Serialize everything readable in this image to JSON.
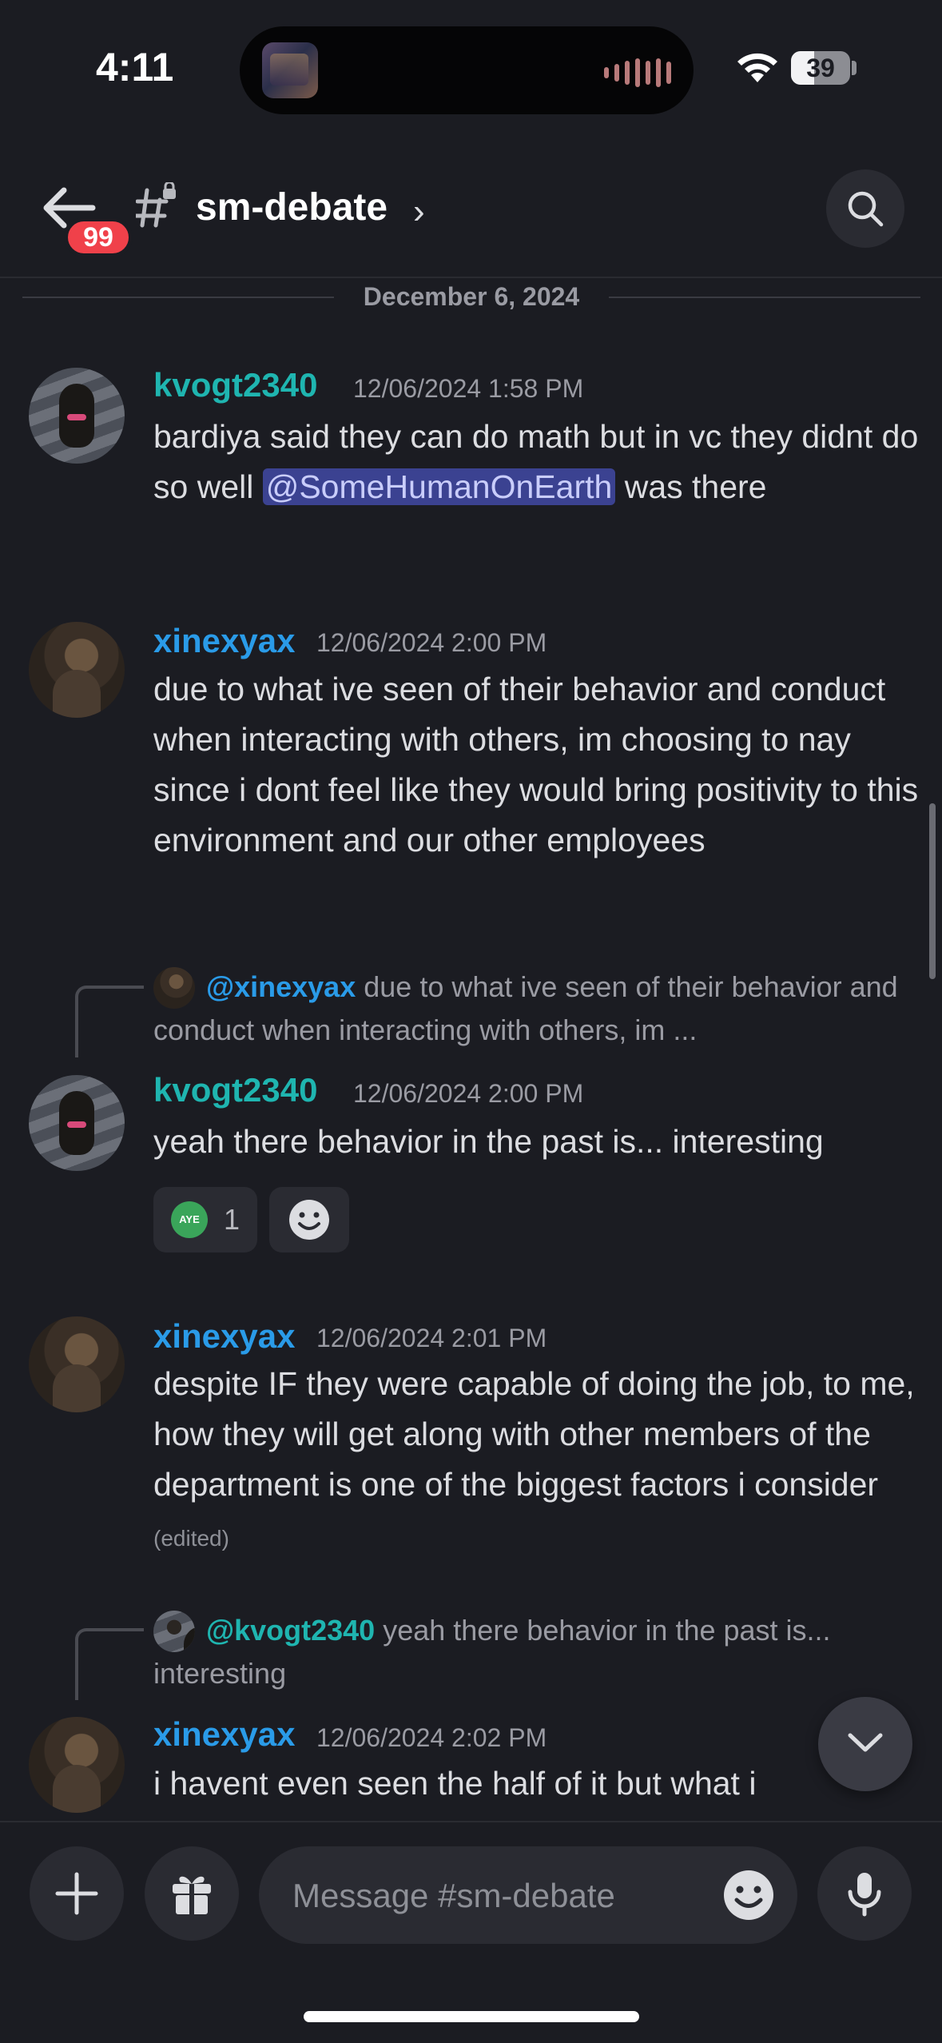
{
  "status_bar": {
    "time": "4:11",
    "battery": "39"
  },
  "header": {
    "unread_badge": "99",
    "channel_name": "sm-debate",
    "chevron": "›"
  },
  "date_divider": "December 6, 2024",
  "messages": [
    {
      "author": "kvogt2340",
      "timestamp": "12/06/2024 1:58 PM",
      "text_before": "bardiya said they can do math but in vc they didnt do so well ",
      "mention": "@SomeHumanOnEarth",
      "text_after": " was there"
    },
    {
      "author": "xinexyax",
      "timestamp": "12/06/2024 2:00 PM",
      "text": "due to what ive seen of their behavior and conduct when interacting with others, im choosing to nay since i dont feel like they would bring positivity to this environment and our other employees"
    },
    {
      "author": "kvogt2340",
      "timestamp": "12/06/2024 2:00 PM",
      "reply_to": "@xinexyax",
      "reply_text": "due to what ive seen of their behavior and conduct when interacting with others, im ...",
      "text": "yeah there behavior in the past is... interesting",
      "reaction": {
        "emoji_label": "AYE",
        "count": "1"
      }
    },
    {
      "author": "xinexyax",
      "timestamp": "12/06/2024 2:01 PM",
      "text": "despite IF they were capable of doing the job, to me, how they will get along with other members of the department is one of the biggest factors i consider",
      "edited": "(edited)"
    },
    {
      "author": "xinexyax",
      "timestamp": "12/06/2024 2:02 PM",
      "reply_to": "@kvogt2340",
      "reply_text": "yeah there behavior in the past is... interesting",
      "text": "i havent even seen the half of it but what i"
    }
  ],
  "composer": {
    "placeholder": "Message #sm-debate"
  },
  "colors": {
    "accent_teal": "#1fb5b0",
    "accent_blue": "#2a9be8",
    "badge_red": "#f0414a",
    "mention_bg": "#3b4291",
    "background": "#1b1c22"
  },
  "icons": [
    "back-arrow-icon",
    "channel-hash-lock-icon",
    "search-icon",
    "plus-icon",
    "gift-icon",
    "emoji-icon",
    "microphone-icon",
    "chevron-down-icon",
    "wifi-icon",
    "battery-icon"
  ]
}
